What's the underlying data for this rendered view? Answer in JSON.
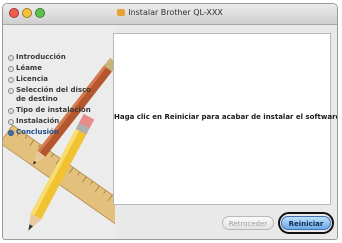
{
  "window": {
    "title": "Instalar Brother QL-XXX",
    "colors": {
      "close": "#f05a50",
      "minimize": "#f6c13d",
      "zoom": "#5fc04e"
    }
  },
  "sidebar": {
    "steps": [
      {
        "label": "Introducción",
        "active": false
      },
      {
        "label": "Léame",
        "active": false
      },
      {
        "label": "Licencia",
        "active": false
      },
      {
        "label": "Selección del disco",
        "label2": "de destino",
        "active": false
      },
      {
        "label": "Tipo de instalación",
        "active": false
      },
      {
        "label": "Instalación",
        "active": false
      },
      {
        "label": "Conclusión",
        "active": true
      }
    ]
  },
  "main": {
    "message": "Haga clic en Reiniciar para acabar de instalar el software."
  },
  "buttons": {
    "back_label": "Retroceder",
    "restart_label": "Reiniciar"
  }
}
